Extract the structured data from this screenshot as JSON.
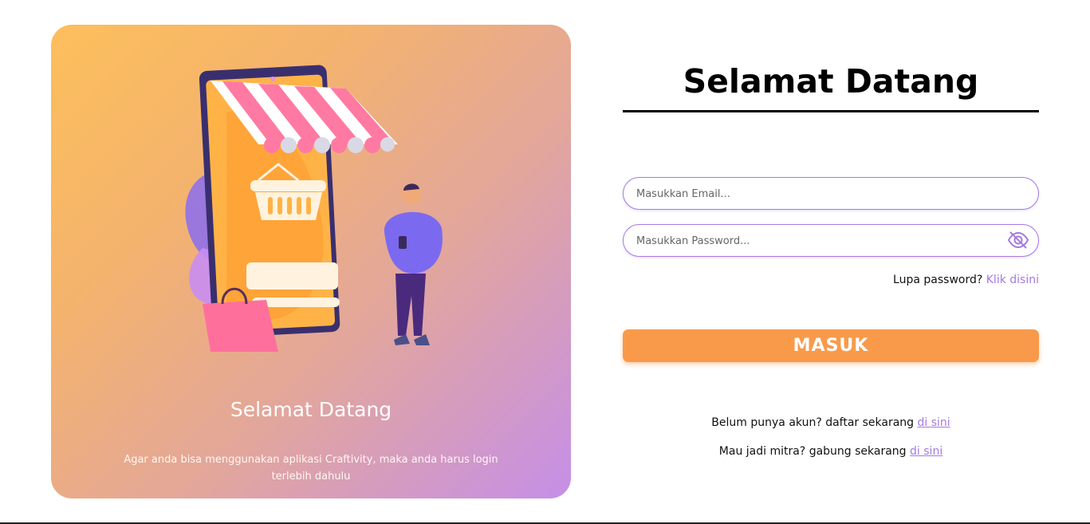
{
  "promo": {
    "title": "Selamat Datang",
    "description": "Agar anda bisa menggunakan aplikasi Craftivity, maka anda harus login terlebih dahulu"
  },
  "form": {
    "title": "Selamat Datang",
    "email_placeholder": "Masukkan Email...",
    "password_placeholder": "Masukkan Password...",
    "forgot_text": "Lupa password?",
    "forgot_link": "Klik disini",
    "submit_label": "MASUK",
    "register_text": "Belum punya akun? daftar sekarang",
    "register_link": "di sini",
    "partner_text": "Mau jadi mitra? gabung sekarang",
    "partner_link": "di sini"
  },
  "colors": {
    "accent_orange": "#f99a4a",
    "accent_purple": "#a47ae0",
    "card_gradient_start": "#fdbf5c",
    "card_gradient_end": "#c58fe8"
  },
  "icons": {
    "password_toggle": "eye-slash-icon",
    "illustration": "online-shop-illustration"
  }
}
